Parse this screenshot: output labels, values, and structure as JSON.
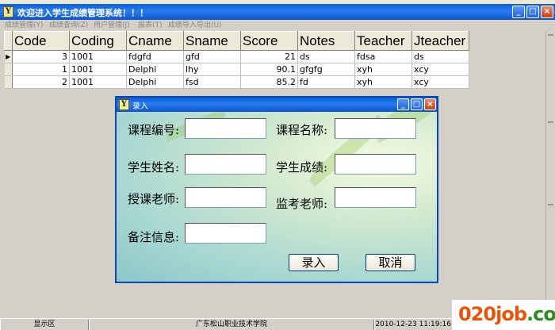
{
  "window": {
    "title": "欢迎进入学生成绩管理系统！！！"
  },
  "menu": [
    "成绩管理(Y)",
    "成绩查询(Z)",
    "用户管理(J)",
    "报表(T)",
    "成绩导入导出(U)"
  ],
  "grid": {
    "columns": [
      "Code",
      "Coding",
      "Cname",
      "Sname",
      "Score",
      "Notes",
      "Teacher",
      "Jteacher"
    ],
    "rows": [
      {
        "code": "3",
        "coding": "1001",
        "cname": "fdgfd",
        "sname": "gfd",
        "score": "21",
        "notes": "ds",
        "teacher": "fdsa",
        "jteacher": "ds",
        "current": true
      },
      {
        "code": "1",
        "coding": "1001",
        "cname": "Delphi",
        "sname": "lhy",
        "score": "90.1",
        "notes": "gfgfg",
        "teacher": "xyh",
        "jteacher": "xcy",
        "current": false
      },
      {
        "code": "2",
        "coding": "1001",
        "cname": "Delphi",
        "sname": "fsd",
        "score": "85.2",
        "notes": "fd",
        "teacher": "xyh",
        "jteacher": "xcy",
        "current": false
      }
    ]
  },
  "dialog": {
    "title": "录入",
    "fields": [
      {
        "label": "课程编号:",
        "value": ""
      },
      {
        "label": "课程名称:",
        "value": ""
      },
      {
        "label": "学生姓名:",
        "value": ""
      },
      {
        "label": "学生成绩:",
        "value": ""
      },
      {
        "label": "授课老师:",
        "value": ""
      },
      {
        "label": "监考老师:",
        "value": ""
      },
      {
        "label": "备注信息:",
        "value": ""
      }
    ],
    "submit_label": "录入",
    "cancel_label": "取消"
  },
  "status": {
    "area": "显示区",
    "school": "广东松山职业技术学院",
    "datetime": "2010-12-23 11:19:16"
  },
  "watermark": {
    "part1": "020job",
    "part2": ".com"
  }
}
